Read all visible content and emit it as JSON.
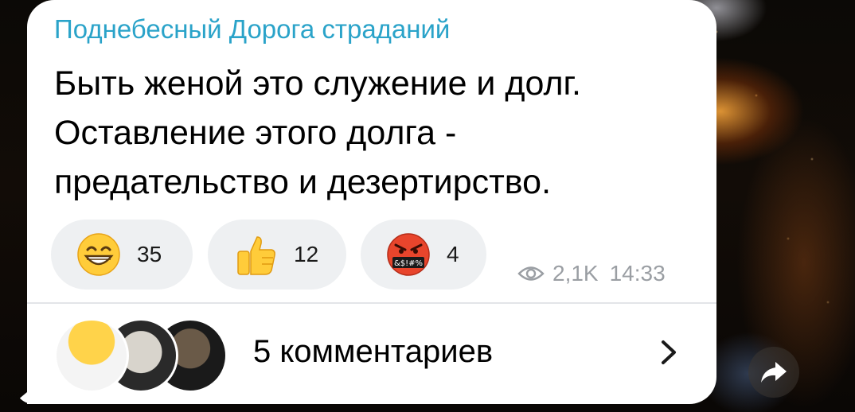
{
  "message": {
    "sender_name": "Поднебесный Дорога страданий",
    "text_lines": [
      "Быть женой это служение и долг.",
      "Оставление этого долга -",
      "предательство и дезертирство."
    ]
  },
  "reactions": [
    {
      "icon": "grinning-face-emoji",
      "count": "35"
    },
    {
      "icon": "thumbs-up-emoji",
      "count": "12"
    },
    {
      "icon": "cursing-face-emoji",
      "count": "4",
      "symbols": "&$!#%"
    }
  ],
  "meta": {
    "views": "2,1K",
    "time": "14:33",
    "views_icon": "eye-icon"
  },
  "comments": {
    "label": "5 комментариев",
    "avatar_count": 3,
    "chevron_icon": "chevron-right-icon"
  },
  "share": {
    "icon": "share-arrow-icon"
  },
  "colors": {
    "sender": "#2aa3c9",
    "bubble": "#ffffff",
    "reaction_bg": "#eef0f2",
    "meta_text": "#9a9ea3"
  }
}
